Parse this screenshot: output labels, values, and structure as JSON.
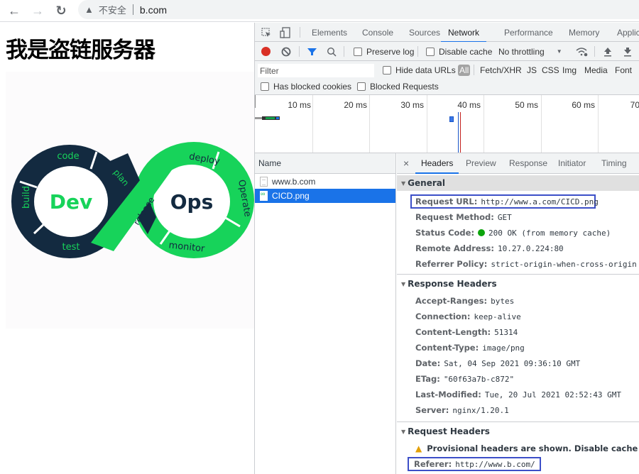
{
  "browser": {
    "back_icon": "←",
    "forward_icon": "→",
    "reload_icon": "↻",
    "security_icon": "▲",
    "security_label": "不安全",
    "url": "b.com"
  },
  "page": {
    "heading": "我是盗链服务器",
    "image": {
      "left_word": "Dev",
      "right_word": "Ops",
      "stages": [
        "code",
        "plan",
        "build",
        "test",
        "release",
        "deploy",
        "Operate",
        "monitor"
      ],
      "colors": {
        "dark": "#132a40",
        "green": "#17d35a"
      }
    }
  },
  "devtools": {
    "tabs": [
      "Elements",
      "Console",
      "Sources",
      "Network",
      "Performance",
      "Memory",
      "Applic"
    ],
    "active_tab": "Network",
    "toolbar": {
      "preserve_log": "Preserve log",
      "disable_cache": "Disable cache",
      "throttling": "No throttling",
      "record_color": "#d93025",
      "filter_color": "#1a73e8"
    },
    "filterbar": {
      "filter_placeholder": "Filter",
      "hide_data_urls": "Hide data URLs",
      "types": [
        "All",
        "Fetch/XHR",
        "JS",
        "CSS",
        "Img",
        "Media",
        "Font"
      ],
      "has_blocked_cookies": "Has blocked cookies",
      "blocked_requests": "Blocked Requests"
    },
    "timeline": {
      "ticks": [
        "10 ms",
        "20 ms",
        "30 ms",
        "40 ms",
        "50 ms",
        "60 ms",
        "70"
      ]
    },
    "request_list": {
      "header": "Name",
      "rows": [
        {
          "name": "www.b.com",
          "type": "document",
          "selected": false
        },
        {
          "name": "CICD.png",
          "type": "image",
          "selected": true
        }
      ]
    },
    "details": {
      "close_icon": "×",
      "tabs": [
        "Headers",
        "Preview",
        "Response",
        "Initiator",
        "Timing"
      ],
      "active_tab": "Headers",
      "general": {
        "title": "General",
        "rows": [
          {
            "key": "Request URL:",
            "value": "http://www.a.com/CICD.png"
          },
          {
            "key": "Request Method:",
            "value": "GET"
          },
          {
            "key": "Status Code:",
            "value": "200 OK (from memory cache)"
          },
          {
            "key": "Remote Address:",
            "value": "10.27.0.224:80"
          },
          {
            "key": "Referrer Policy:",
            "value": "strict-origin-when-cross-origin"
          }
        ]
      },
      "response_headers": {
        "title": "Response Headers",
        "rows": [
          {
            "key": "Accept-Ranges:",
            "value": "bytes"
          },
          {
            "key": "Connection:",
            "value": "keep-alive"
          },
          {
            "key": "Content-Length:",
            "value": "51314"
          },
          {
            "key": "Content-Type:",
            "value": "image/png"
          },
          {
            "key": "Date:",
            "value": "Sat, 04 Sep 2021 09:36:10 GMT"
          },
          {
            "key": "ETag:",
            "value": "\"60f63a7b-c872\""
          },
          {
            "key": "Last-Modified:",
            "value": "Tue, 20 Jul 2021 02:52:43 GMT"
          },
          {
            "key": "Server:",
            "value": "nginx/1.20.1"
          }
        ]
      },
      "request_headers": {
        "title": "Request Headers",
        "warning": "Provisional headers are shown. Disable cache to see f",
        "rows": [
          {
            "key": "Referer:",
            "value": "http://www.b.com/"
          }
        ]
      },
      "highlight_color": "#3c4fc8"
    }
  }
}
